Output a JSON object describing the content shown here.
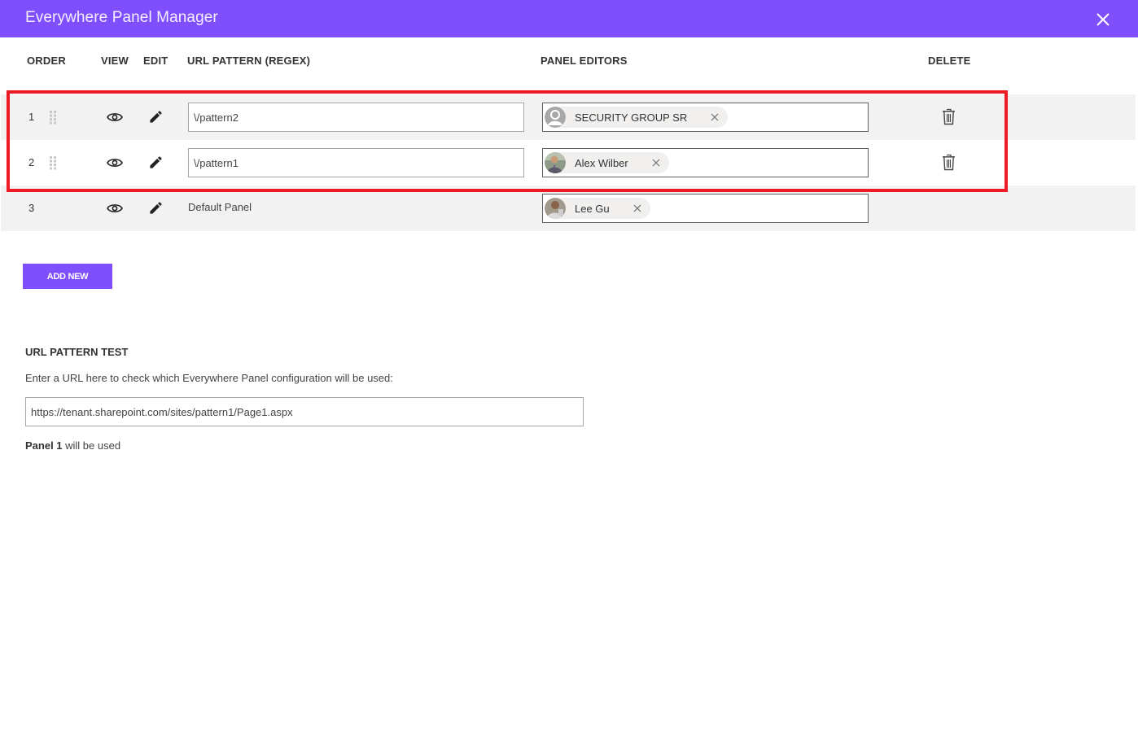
{
  "window": {
    "title": "Everywhere Panel Manager",
    "close_icon": "close-icon"
  },
  "columns": {
    "order": "ORDER",
    "view": "VIEW",
    "edit": "EDIT",
    "url_pattern": "URL PATTERN (REGEX)",
    "panel_editors": "PANEL EDITORS",
    "delete": "DELETE"
  },
  "rows": [
    {
      "order": "1",
      "draggable": true,
      "url_pattern": "\\/pattern2",
      "editable_pattern": true,
      "editors": [
        {
          "name": "SECURITY GROUP SR",
          "avatar": "generic-person"
        }
      ],
      "deletable": true
    },
    {
      "order": "2",
      "draggable": true,
      "url_pattern": "\\/pattern1",
      "editable_pattern": true,
      "editors": [
        {
          "name": "Alex Wilber",
          "avatar": "photo"
        }
      ],
      "deletable": true
    },
    {
      "order": "3",
      "draggable": false,
      "url_pattern": "Default Panel",
      "editable_pattern": false,
      "editors": [
        {
          "name": "Lee Gu",
          "avatar": "photo"
        }
      ],
      "deletable": false
    }
  ],
  "add_button": "ADD NEW",
  "test": {
    "title": "URL PATTERN TEST",
    "description": "Enter a URL here to check which Everywhere Panel configuration will be used:",
    "url_value": "https://tenant.sharepoint.com/sites/pattern1/Page1.aspx",
    "result_bold": "Panel 1",
    "result_rest": " will be used"
  },
  "colors": {
    "accent": "#7f4ffd",
    "highlight": "#ed1c24",
    "row_shade": "#f2f2f2"
  }
}
